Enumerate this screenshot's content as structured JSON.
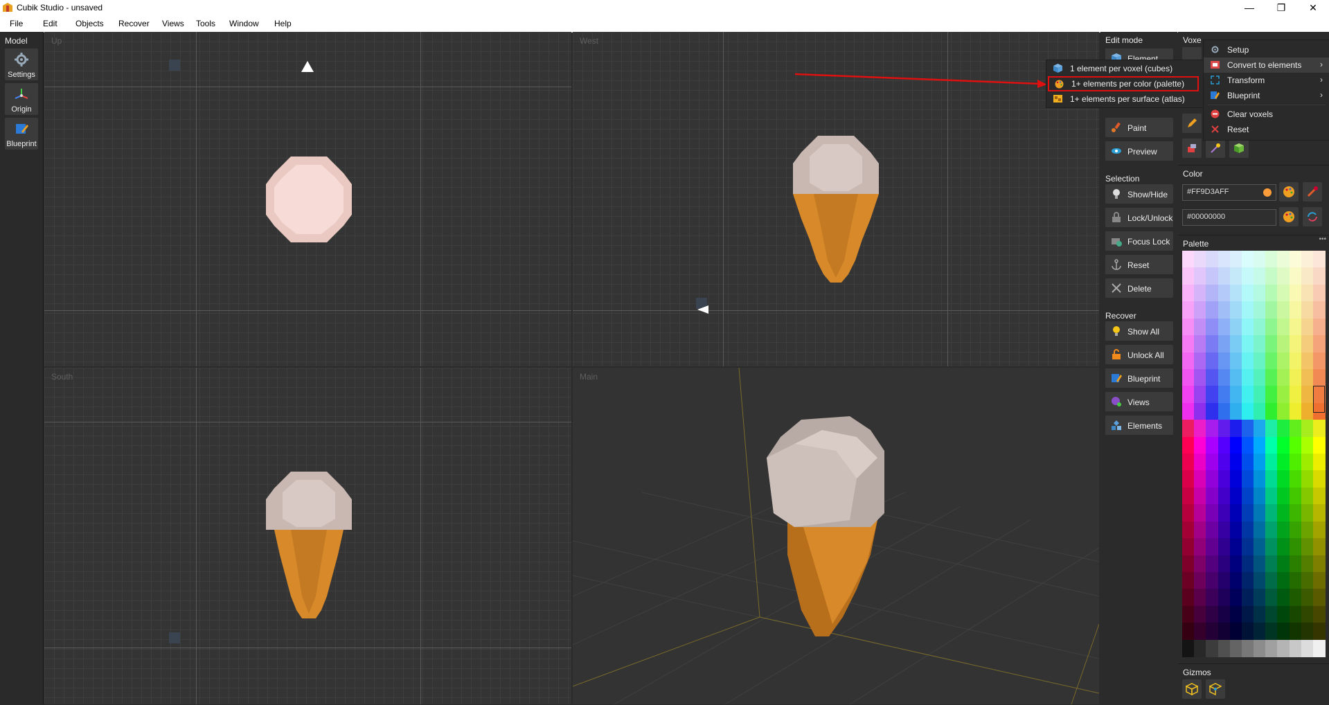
{
  "window": {
    "title": "Cubik Studio - unsaved",
    "controls": {
      "minimize": "—",
      "maximize": "❐",
      "close": "✕"
    }
  },
  "menubar": [
    "File",
    "Edit",
    "Objects",
    "Recover",
    "Views",
    "Tools",
    "Window",
    "Help"
  ],
  "left_toolbar": {
    "title": "Model",
    "buttons": [
      {
        "label": "Settings",
        "icon": "gear-icon"
      },
      {
        "label": "Origin",
        "icon": "axis-origin-icon"
      },
      {
        "label": "Blueprint",
        "icon": "blueprint-icon"
      }
    ]
  },
  "viewports": {
    "up": "Up",
    "west": "West",
    "south": "South",
    "main": "Main"
  },
  "edit_panel": {
    "title": "Edit mode",
    "element_label": "Element",
    "buttons": [
      {
        "label": "Paint",
        "icon": "paint-brush-icon",
        "accent": "#e05a2a"
      },
      {
        "label": "Preview",
        "icon": "eye-icon",
        "accent": "#2aa0d6"
      }
    ]
  },
  "selection_panel": {
    "title": "Selection",
    "buttons": [
      {
        "label": "Show/Hide",
        "icon": "lightbulb-icon"
      },
      {
        "label": "Lock/Unlock",
        "icon": "lock-icon"
      },
      {
        "label": "Focus Lock",
        "icon": "focus-lock-icon"
      },
      {
        "label": "Reset",
        "icon": "anchor-icon"
      },
      {
        "label": "Delete",
        "icon": "delete-x-icon"
      }
    ]
  },
  "recover_panel": {
    "title": "Recover",
    "buttons": [
      {
        "label": "Show All",
        "icon": "lightbulb-on-icon"
      },
      {
        "label": "Unlock All",
        "icon": "unlock-icon"
      },
      {
        "label": "Blueprint",
        "icon": "blueprint-icon"
      },
      {
        "label": "Views",
        "icon": "views-icon"
      },
      {
        "label": "Elements",
        "icon": "elements-icon"
      }
    ]
  },
  "voxel_panel": {
    "title": "Voxe"
  },
  "voxel_menu": {
    "items": [
      {
        "label": "Setup",
        "icon": "gear-icon",
        "submenu": false
      },
      {
        "label": "Convert to elements",
        "icon": "convert-icon",
        "submenu": true,
        "active": true
      },
      {
        "label": "Transform",
        "icon": "transform-icon",
        "submenu": true
      },
      {
        "label": "Blueprint",
        "icon": "blueprint-icon",
        "submenu": true
      },
      {
        "label": "Clear voxels",
        "icon": "clear-icon",
        "submenu": false
      },
      {
        "label": "Reset",
        "icon": "reset-x-icon",
        "submenu": false
      }
    ],
    "submenu_arrow": "›"
  },
  "convert_submenu": {
    "items": [
      {
        "label": "1 element per voxel (cubes)",
        "icon": "cube-icon"
      },
      {
        "label": "1+ elements per color (palette)",
        "icon": "palette-icon",
        "highlighted": true
      },
      {
        "label": "1+ elements per surface (atlas)",
        "icon": "atlas-icon"
      }
    ]
  },
  "color_panel": {
    "title": "Color",
    "primary": "#FF9D3AFF",
    "secondary": "#00000000",
    "primary_swatch": "#FF9D3A"
  },
  "palette_panel": {
    "title": "Palette",
    "more": "•••"
  },
  "gizmos_panel": {
    "title": "Gizmos"
  },
  "colors": {
    "highlight_red": "#e01010",
    "cone": "#d88a2a",
    "scoop": "#c9bcb6"
  }
}
